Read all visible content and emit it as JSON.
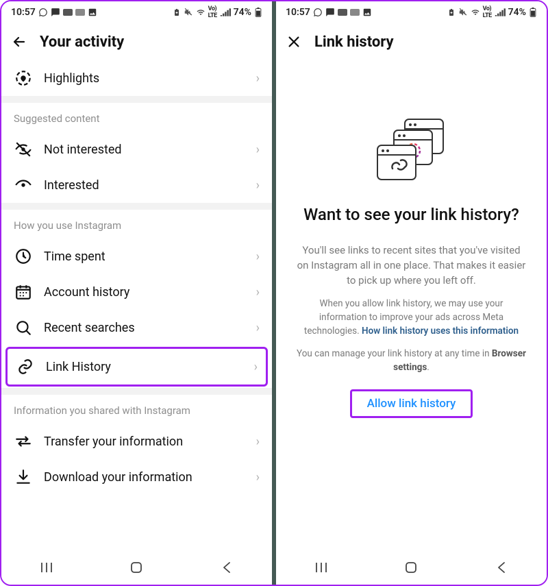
{
  "statusbar": {
    "time": "10:57",
    "battery_text": "74%"
  },
  "left": {
    "header_title": "Your activity",
    "rows": {
      "highlights": "Highlights",
      "not_interested": "Not interested",
      "interested": "Interested",
      "time_spent": "Time spent",
      "account_history": "Account history",
      "recent_searches": "Recent searches",
      "link_history": "Link History",
      "transfer": "Transfer your information",
      "download": "Download your information"
    },
    "sections": {
      "suggested": "Suggested content",
      "how_use": "How you use Instagram",
      "info_shared": "Information you shared with Instagram"
    }
  },
  "right": {
    "header_title": "Link history",
    "heading": "Want to see your link history?",
    "p1": "You'll see links to recent sites that you've visited on Instagram all in one place. That makes it easier to pick up where you left off.",
    "p2a": "When you allow link history, we may use your information to improve your ads across Meta technologies. ",
    "p2_link": "How link history uses this information",
    "p3a": "You can manage your link history at any time in ",
    "p3_bold": "Browser settings",
    "p3b": ".",
    "allow": "Allow link history"
  }
}
